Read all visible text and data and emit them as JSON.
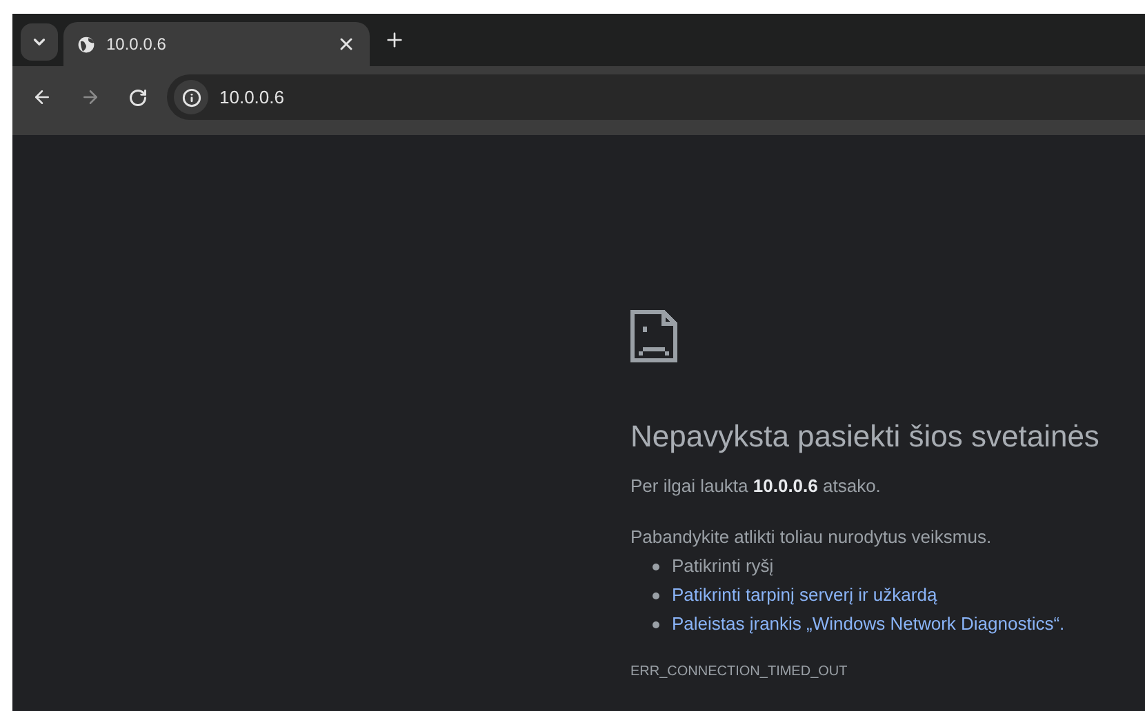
{
  "tab": {
    "title": "10.0.0.6",
    "selected": true
  },
  "address_bar": {
    "url": "10.0.0.6"
  },
  "error": {
    "heading": "Nepavyksta pasiekti šios svetainės",
    "message": "Per ilgai laukta **10.0.0.6** atsako.",
    "suggestions_intro": "Pabandykite atlikti toliau nurodytus veiksmus.",
    "suggestions": [
      {
        "text": "Patikrinti ryšį",
        "kind": "text"
      },
      {
        "text": "Patikrinti tarpinį serverį ir užkardą",
        "kind": "link"
      },
      {
        "text": "Paleistas įrankis „Windows Network Diagnostics“.",
        "kind": "link"
      }
    ],
    "code": "ERR_CONNECTION_TIMED_OUT"
  }
}
